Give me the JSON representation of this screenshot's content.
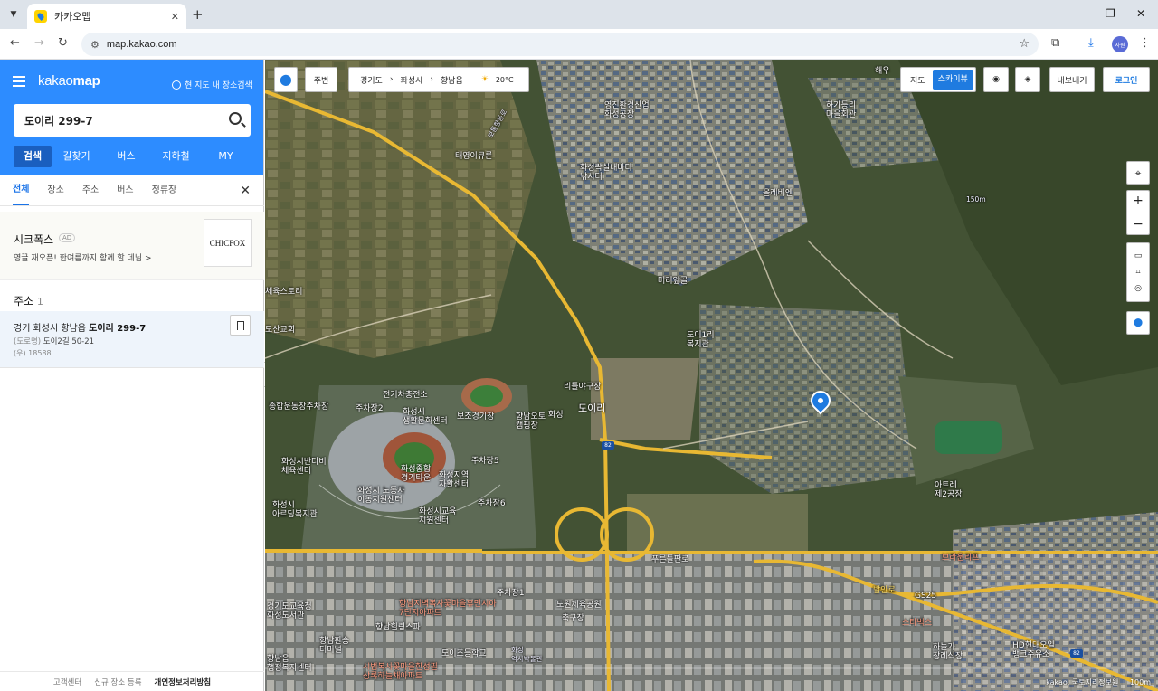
{
  "browser": {
    "tab_title": "카카오맵",
    "url": "map.kakao.com"
  },
  "sidebar": {
    "logo_light": "kakao",
    "logo_bold": "map",
    "nearby_label": "현 지도 내 장소검색",
    "search_query": "도이리 299-7",
    "main_tabs": [
      "검색",
      "길찾기",
      "버스",
      "지하철",
      "MY"
    ],
    "sub_tabs": [
      "전체",
      "장소",
      "주소",
      "버스",
      "정류장"
    ],
    "ad": {
      "name": "시크폭스",
      "tag": "AD",
      "desc": "영끌 재오픈! 한여름까지 함께 할 데님 >",
      "logo_text": "CHICFOX"
    },
    "address_section": {
      "title": "주소",
      "count": "1"
    },
    "result": {
      "prefix": "경기 화성시 향남읍 ",
      "bold": "도이리 299-7",
      "road_label": "(도로명)",
      "road_value": "도이2길 50-21",
      "zip": "(우) 18588"
    },
    "footer": [
      "고객센터",
      "신규 장소 등록",
      "개인정보처리방침"
    ]
  },
  "map": {
    "nearby_btn": "주변",
    "breadcrumb": [
      "경기도",
      "화성시",
      "향남읍"
    ],
    "weather": "20°C",
    "map_type": [
      "지도",
      "스카이뷰"
    ],
    "export_btn": "내보내기",
    "login_btn": "로그인",
    "copyright": "kakao, 국토지리정보원",
    "scale": "100m",
    "labels": [
      {
        "t": "해우",
        "c": ""
      },
      {
        "t": "하가등리\n마을회관",
        "c": ""
      },
      {
        "t": "영진환경산업\n화성공장",
        "c": ""
      },
      {
        "t": "화성락실내바다\n낚시터",
        "c": ""
      },
      {
        "t": "태영이큐론",
        "c": ""
      },
      {
        "t": "올레비엔",
        "c": ""
      },
      {
        "t": "머리앞골",
        "c": ""
      },
      {
        "t": "도이1리\n복지관",
        "c": ""
      },
      {
        "t": "리틀야구장",
        "c": ""
      },
      {
        "t": "화성",
        "c": ""
      },
      {
        "t": "도이리",
        "c": ""
      },
      {
        "t": "종합운동장주차장",
        "c": ""
      },
      {
        "t": "전기차충전소",
        "c": ""
      },
      {
        "t": "주차장2",
        "c": ""
      },
      {
        "t": "화성시\n생활문화센터",
        "c": ""
      },
      {
        "t": "보조경기장",
        "c": ""
      },
      {
        "t": "향남오토\n캠핑장",
        "c": ""
      },
      {
        "t": "주차장5",
        "c": ""
      },
      {
        "t": "화성시반다비\n체육센터",
        "c": ""
      },
      {
        "t": "화성종합\n경기타운",
        "c": ""
      },
      {
        "t": "화성시 노동자\n이동지원센터",
        "c": ""
      },
      {
        "t": "화성지역\n자활센터",
        "c": ""
      },
      {
        "t": "주차장6",
        "c": ""
      },
      {
        "t": "화성시\n아르딩복지관",
        "c": ""
      },
      {
        "t": "화성시교육\n지원센터",
        "c": ""
      },
      {
        "t": "아트레\n제2공장",
        "c": ""
      },
      {
        "t": "브라운리프",
        "c": "r"
      },
      {
        "t": "GS25",
        "c": ""
      },
      {
        "t": "스타벅스",
        "c": "r"
      },
      {
        "t": "HD현대오일\n뱅크주유소",
        "c": ""
      },
      {
        "t": "하늘가\n장례식장",
        "c": ""
      },
      {
        "t": "발안로",
        "c": "y"
      },
      {
        "t": "푸른들판로",
        "c": ""
      },
      {
        "t": "주차장1",
        "c": ""
      },
      {
        "t": "도원체육공원",
        "c": ""
      },
      {
        "t": "축구장",
        "c": ""
      },
      {
        "t": "향남지벽복사꽃마을휴먼시아\n7단지아파트",
        "c": "r"
      },
      {
        "t": "경기도교육청\n화성도서관",
        "c": ""
      },
      {
        "t": "향남힐링스파",
        "c": ""
      },
      {
        "t": "향남읍\n행정복지센터",
        "c": ""
      },
      {
        "t": "도이초등학교",
        "c": ""
      },
      {
        "t": "시범복사꽃마을한성필\n상록하늘채아파트",
        "c": "r"
      },
      {
        "t": "화성\n역사박물관",
        "c": "s"
      },
      {
        "t": "향남환승\n터미널",
        "c": ""
      },
      {
        "t": "도산교회",
        "c": ""
      },
      {
        "t": "체육스토리",
        "c": ""
      },
      {
        "t": "보통향동로",
        "c": "s"
      },
      {
        "t": "150m",
        "c": "s"
      }
    ]
  }
}
